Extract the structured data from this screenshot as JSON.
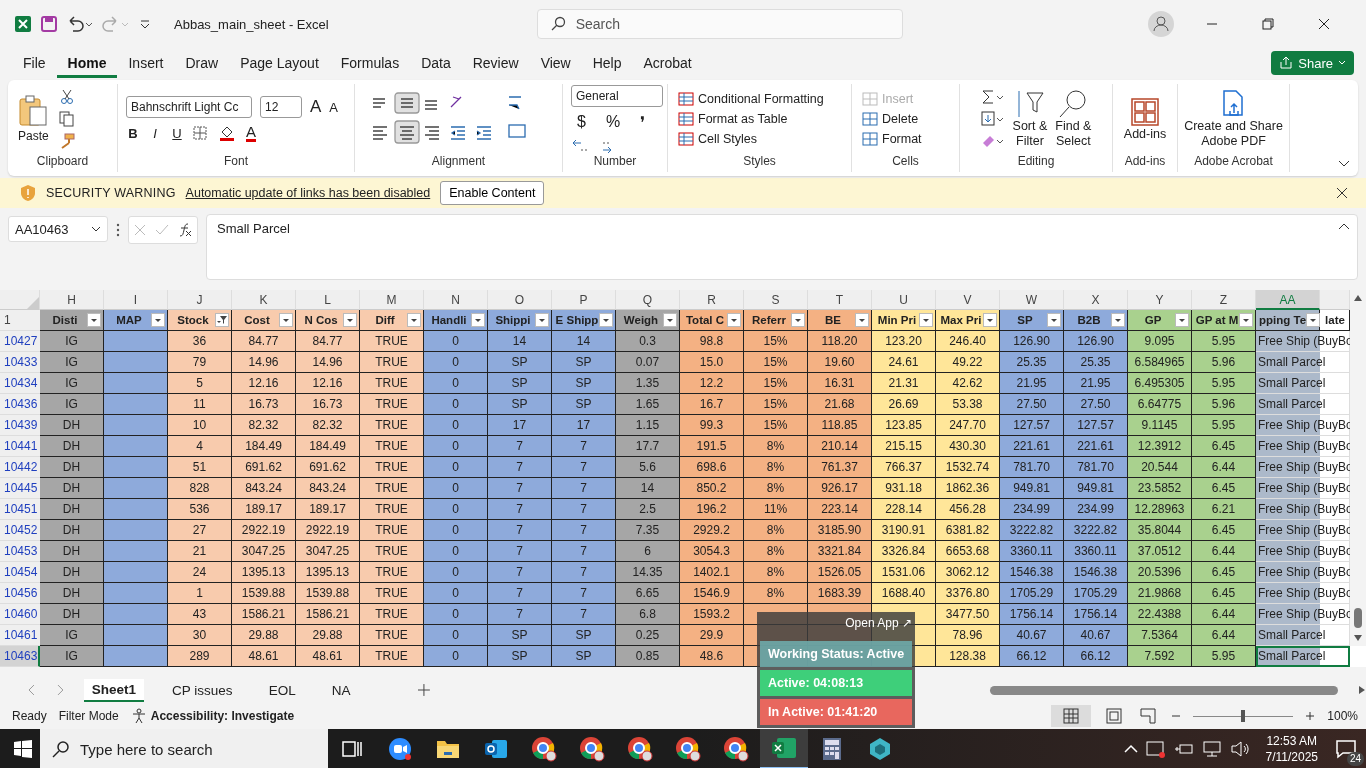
{
  "title_bar": {
    "title": "Abbas_main_sheet  -  Excel",
    "search_placeholder": "Search"
  },
  "menu_tabs": [
    {
      "label": "File",
      "selected": false
    },
    {
      "label": "Home",
      "selected": true
    },
    {
      "label": "Insert",
      "selected": false
    },
    {
      "label": "Draw",
      "selected": false
    },
    {
      "label": "Page Layout",
      "selected": false
    },
    {
      "label": "Formulas",
      "selected": false
    },
    {
      "label": "Data",
      "selected": false
    },
    {
      "label": "Review",
      "selected": false
    },
    {
      "label": "View",
      "selected": false
    },
    {
      "label": "Help",
      "selected": false
    },
    {
      "label": "Acrobat",
      "selected": false
    }
  ],
  "share_button": "Share",
  "ribbon": {
    "clipboard": {
      "label": "Clipboard",
      "paste": "Paste"
    },
    "font": {
      "label": "Font",
      "font_name": "Bahnschrift Light Cc",
      "font_size": "12",
      "grow": "A",
      "shrink": "A",
      "bold": "B",
      "italic": "I",
      "underline": "U",
      "font_color": "A"
    },
    "alignment": {
      "label": "Alignment"
    },
    "number": {
      "label": "Number",
      "format": "General",
      "currency": "$",
      "percent": "%",
      "comma": "❜"
    },
    "styles": {
      "label": "Styles",
      "items": [
        "Conditional Formatting",
        "Format as Table",
        "Cell Styles"
      ]
    },
    "cells": {
      "label": "Cells",
      "items": [
        {
          "label": "Insert",
          "disabled": true
        },
        {
          "label": "Delete",
          "disabled": false
        },
        {
          "label": "Format",
          "disabled": false
        }
      ]
    },
    "editing": {
      "label": "Editing",
      "sort": "Sort &",
      "sort2": "Filter",
      "find": "Find &",
      "find2": "Select"
    },
    "addins": {
      "label": "Add-ins",
      "button": "Add-ins"
    },
    "acrobat": {
      "label": "Adobe Acrobat",
      "button": "Create and Share",
      "button2": "Adobe PDF"
    }
  },
  "security_bar": {
    "label": "SECURITY WARNING",
    "message": "Automatic update of links has been disabled",
    "button": "Enable Content"
  },
  "formula_bar": {
    "name_box": "AA10463",
    "value": "Small Parcel"
  },
  "sheet": {
    "column_letters": [
      {
        "label": "H",
        "selected": false
      },
      {
        "label": "I",
        "selected": false
      },
      {
        "label": "J",
        "selected": false
      },
      {
        "label": "K",
        "selected": false
      },
      {
        "label": "L",
        "selected": false
      },
      {
        "label": "M",
        "selected": false
      },
      {
        "label": "N",
        "selected": false
      },
      {
        "label": "O",
        "selected": false
      },
      {
        "label": "P",
        "selected": false
      },
      {
        "label": "Q",
        "selected": false
      },
      {
        "label": "R",
        "selected": false
      },
      {
        "label": "S",
        "selected": false
      },
      {
        "label": "T",
        "selected": false
      },
      {
        "label": "U",
        "selected": false
      },
      {
        "label": "V",
        "selected": false
      },
      {
        "label": "W",
        "selected": false
      },
      {
        "label": "X",
        "selected": false
      },
      {
        "label": "Y",
        "selected": false
      },
      {
        "label": "Z",
        "selected": false
      },
      {
        "label": "AA",
        "selected": true
      }
    ],
    "header_row_number": "1",
    "headers": [
      {
        "label": "Disti",
        "color": "#a6a6a6",
        "filtered": false
      },
      {
        "label": "MAP",
        "color": "#8eaadb",
        "filtered": false
      },
      {
        "label": "Stock",
        "color": "#f8cbad",
        "filtered": true
      },
      {
        "label": "Cost",
        "color": "#f8cbad",
        "filtered": false
      },
      {
        "label": "N Cos",
        "color": "#f8cbad",
        "filtered": false
      },
      {
        "label": "Diff",
        "color": "#f8cbad",
        "filtered": false
      },
      {
        "label": "Handli",
        "color": "#8eaadb",
        "filtered": false
      },
      {
        "label": "Shippi",
        "color": "#8eaadb",
        "filtered": false
      },
      {
        "label": "E Shipp",
        "color": "#8eaadb",
        "filtered": false
      },
      {
        "label": "Weigh",
        "color": "#a6a6a6",
        "filtered": false
      },
      {
        "label": "Total C",
        "color": "#f4b183",
        "filtered": false
      },
      {
        "label": "Referr",
        "color": "#f4b183",
        "filtered": false
      },
      {
        "label": "BE",
        "color": "#f4b183",
        "filtered": false
      },
      {
        "label": "Min Pri",
        "color": "#ffe699",
        "filtered": false
      },
      {
        "label": "Max Pri",
        "color": "#ffe699",
        "filtered": false
      },
      {
        "label": "SP",
        "color": "#8eaadb",
        "filtered": false
      },
      {
        "label": "B2B",
        "color": "#8eaadb",
        "filtered": false
      },
      {
        "label": "GP",
        "color": "#a9d18e",
        "filtered": false
      },
      {
        "label": "GP at M",
        "color": "#a9d18e",
        "filtered": false
      },
      {
        "label": "pping Te",
        "color": "#acb9ca",
        "filtered": false
      },
      {
        "label": "late",
        "color": "#ffffff"
      }
    ],
    "rows": [
      {
        "number": "10427",
        "selected": false,
        "cells": [
          "IG",
          null,
          "36",
          "84.77",
          "84.77",
          "TRUE",
          "0",
          "14",
          "14",
          "0.3",
          "98.8",
          "15%",
          "118.20",
          "123.20",
          "246.40",
          "126.90",
          "126.90",
          "9.095",
          "5.95",
          "Free Ship (BuyBo"
        ]
      },
      {
        "number": "10433",
        "selected": false,
        "cells": [
          "IG",
          null,
          "79",
          "14.96",
          "14.96",
          "TRUE",
          "0",
          "SP",
          "SP",
          "0.07",
          "15.0",
          "15%",
          "19.60",
          "24.61",
          "49.22",
          "25.35",
          "25.35",
          "6.584965",
          "5.96",
          "Small Parcel"
        ]
      },
      {
        "number": "10434",
        "selected": false,
        "cells": [
          "IG",
          null,
          "5",
          "12.16",
          "12.16",
          "TRUE",
          "0",
          "SP",
          "SP",
          "1.35",
          "12.2",
          "15%",
          "16.31",
          "21.31",
          "42.62",
          "21.95",
          "21.95",
          "6.495305",
          "5.95",
          "Small Parcel"
        ]
      },
      {
        "number": "10436",
        "selected": false,
        "cells": [
          "IG",
          null,
          "11",
          "16.73",
          "16.73",
          "TRUE",
          "0",
          "SP",
          "SP",
          "1.65",
          "16.7",
          "15%",
          "21.68",
          "26.69",
          "53.38",
          "27.50",
          "27.50",
          "6.64775",
          "5.96",
          "Small Parcel"
        ]
      },
      {
        "number": "10439",
        "selected": false,
        "cells": [
          "DH",
          null,
          "10",
          "82.32",
          "82.32",
          "TRUE",
          "0",
          "17",
          "17",
          "1.15",
          "99.3",
          "15%",
          "118.85",
          "123.85",
          "247.70",
          "127.57",
          "127.57",
          "9.1145",
          "5.95",
          "Free Ship (BuyBo"
        ]
      },
      {
        "number": "10441",
        "selected": false,
        "cells": [
          "DH",
          null,
          "4",
          "184.49",
          "184.49",
          "TRUE",
          "0",
          "7",
          "7",
          "17.7",
          "191.5",
          "8%",
          "210.14",
          "215.15",
          "430.30",
          "221.61",
          "221.61",
          "12.3912",
          "6.45",
          "Free Ship (BuyBo"
        ]
      },
      {
        "number": "10442",
        "selected": false,
        "cells": [
          "DH",
          null,
          "51",
          "691.62",
          "691.62",
          "TRUE",
          "0",
          "7",
          "7",
          "5.6",
          "698.6",
          "8%",
          "761.37",
          "766.37",
          "1532.74",
          "781.70",
          "781.70",
          "20.544",
          "6.44",
          "Free Ship (BuyBo"
        ]
      },
      {
        "number": "10445",
        "selected": false,
        "cells": [
          "DH",
          null,
          "828",
          "843.24",
          "843.24",
          "TRUE",
          "0",
          "7",
          "7",
          "14",
          "850.2",
          "8%",
          "926.17",
          "931.18",
          "1862.36",
          "949.81",
          "949.81",
          "23.5852",
          "6.45",
          "Free Ship (BuyBo"
        ]
      },
      {
        "number": "10451",
        "selected": false,
        "cells": [
          "DH",
          null,
          "536",
          "189.17",
          "189.17",
          "TRUE",
          "0",
          "7",
          "7",
          "2.5",
          "196.2",
          "11%",
          "223.14",
          "228.14",
          "456.28",
          "234.99",
          "234.99",
          "12.28963",
          "6.21",
          "Free Ship (BuyBo"
        ]
      },
      {
        "number": "10452",
        "selected": false,
        "cells": [
          "DH",
          null,
          "27",
          "2922.19",
          "2922.19",
          "TRUE",
          "0",
          "7",
          "7",
          "7.35",
          "2929.2",
          "8%",
          "3185.90",
          "3190.91",
          "6381.82",
          "3222.82",
          "3222.82",
          "35.8044",
          "6.45",
          "Free Ship (BuyBo"
        ]
      },
      {
        "number": "10453",
        "selected": false,
        "cells": [
          "DH",
          null,
          "21",
          "3047.25",
          "3047.25",
          "TRUE",
          "0",
          "7",
          "7",
          "6",
          "3054.3",
          "8%",
          "3321.84",
          "3326.84",
          "6653.68",
          "3360.11",
          "3360.11",
          "37.0512",
          "6.44",
          "Free Ship (BuyBo"
        ]
      },
      {
        "number": "10454",
        "selected": false,
        "cells": [
          "DH",
          null,
          "24",
          "1395.13",
          "1395.13",
          "TRUE",
          "0",
          "7",
          "7",
          "14.35",
          "1402.1",
          "8%",
          "1526.05",
          "1531.06",
          "3062.12",
          "1546.38",
          "1546.38",
          "20.5396",
          "6.45",
          "Free Ship (BuyBo"
        ]
      },
      {
        "number": "10456",
        "selected": false,
        "cells": [
          "DH",
          null,
          "1",
          "1539.88",
          "1539.88",
          "TRUE",
          "0",
          "7",
          "7",
          "6.65",
          "1546.9",
          "8%",
          "1683.39",
          "1688.40",
          "3376.80",
          "1705.29",
          "1705.29",
          "21.9868",
          "6.45",
          "Free Ship (BuyBo"
        ]
      },
      {
        "number": "10460",
        "selected": false,
        "cells": [
          "DH",
          null,
          "43",
          "1586.21",
          "1586.21",
          "TRUE",
          "0",
          "7",
          "7",
          "6.8",
          "1593.2",
          null,
          null,
          null,
          "3477.50",
          "1756.14",
          "1756.14",
          "22.4388",
          "6.44",
          "Free Ship (BuyBo"
        ]
      },
      {
        "number": "10461",
        "selected": false,
        "cells": [
          "IG",
          null,
          "30",
          "29.88",
          "29.88",
          "TRUE",
          "0",
          "SP",
          "SP",
          "0.25",
          "29.9",
          null,
          null,
          null,
          "78.96",
          "40.67",
          "40.67",
          "7.5364",
          "6.44",
          "Small Parcel"
        ]
      },
      {
        "number": "10463",
        "selected": true,
        "cells": [
          "IG",
          null,
          "289",
          "48.61",
          "48.61",
          "TRUE",
          "0",
          "SP",
          "SP",
          "0.85",
          "48.6",
          null,
          null,
          null,
          "128.38",
          "66.12",
          "66.12",
          "7.592",
          "5.95",
          "Small Parcel"
        ]
      }
    ]
  },
  "sheet_tabs": [
    {
      "label": "Sheet1",
      "selected": true
    },
    {
      "label": "CP issues",
      "selected": false
    },
    {
      "label": "EOL",
      "selected": false
    },
    {
      "label": "NA",
      "selected": false
    }
  ],
  "status_bar": {
    "mode": "Ready",
    "filter": "Filter Mode",
    "accessibility": "Accessibility: Investigate",
    "zoom": "100%",
    "zoom_level": {
      "level": 0.5
    }
  },
  "status_widget": {
    "open_app": "Open App ↗",
    "status": "Working Status: Active",
    "active": "Active: 04:08:13",
    "inactive": "In Active: 01:41:20"
  },
  "taskbar": {
    "search_placeholder": "Type here to search",
    "time": "12:53 AM",
    "date": "7/11/2025",
    "notifications": "24",
    "apps": [
      {
        "kind": "taskview",
        "selected": false
      },
      {
        "kind": "zoom",
        "selected": false
      },
      {
        "kind": "folder",
        "selected": false
      },
      {
        "kind": "outlook",
        "selected": false
      },
      {
        "kind": "chrome",
        "selected": false
      },
      {
        "kind": "chrome",
        "selected": false
      },
      {
        "kind": "chrome",
        "selected": false
      },
      {
        "kind": "chrome",
        "selected": false
      },
      {
        "kind": "chrome",
        "selected": false
      },
      {
        "kind": "excel",
        "selected": true
      },
      {
        "kind": "calculator",
        "selected": false
      },
      {
        "kind": "hexagon",
        "selected": false
      }
    ]
  }
}
